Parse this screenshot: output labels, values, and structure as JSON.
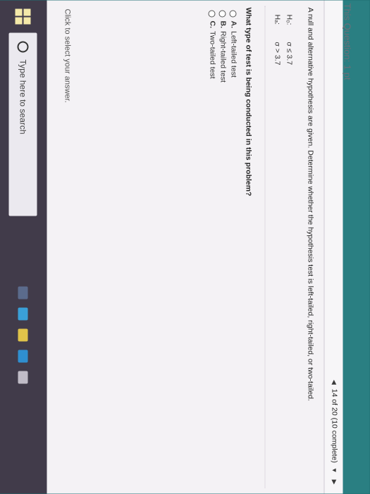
{
  "header": {
    "question_label": "This Question: 1 pt",
    "progress": "14 of 20 (10 complete)"
  },
  "question": {
    "prompt": "A null and alternative hypothesis are given. Determine whether the hypothesis test is left-tailed, right-tailed, or two-tailed.",
    "hypotheses": [
      {
        "name": "H₀:",
        "statement": "σ ≤ 3.7"
      },
      {
        "name": "Hₐ:",
        "statement": "σ > 3.7"
      }
    ],
    "ask": "What type of test is being conducted in this problem?",
    "options": [
      {
        "key": "A.",
        "label": "Left-tailed test"
      },
      {
        "key": "B.",
        "label": "Right-tailed test"
      },
      {
        "key": "C.",
        "label": "Two-tailed test"
      }
    ],
    "click_hint": "Click to select your answer."
  },
  "taskbar": {
    "search_placeholder": "Type here to search"
  },
  "colors": {
    "taskbar": "#413b4a",
    "page": "#f4f2f5",
    "bezel": "#2a7f82"
  }
}
